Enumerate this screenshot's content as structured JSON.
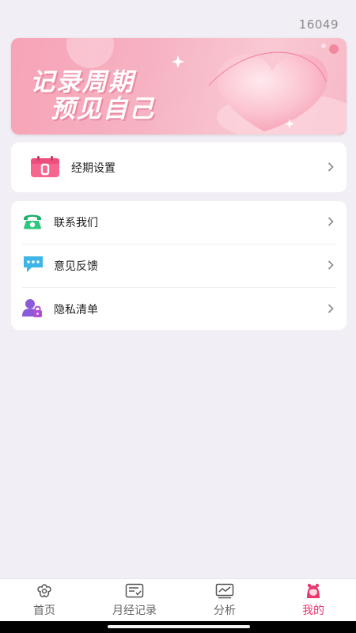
{
  "status": {
    "id_number": "16049"
  },
  "banner": {
    "line1": "记录周期",
    "line2": "预见自己",
    "colors": {
      "accent": "#f7a3b6"
    }
  },
  "period_card": {
    "label": "经期设置",
    "icon": "calendar-icon"
  },
  "menu": {
    "items": [
      {
        "label": "联系我们",
        "icon": "phone-icon"
      },
      {
        "label": "意见反馈",
        "icon": "chat-bubble-icon"
      },
      {
        "label": "隐私清单",
        "icon": "user-lock-icon"
      }
    ]
  },
  "tabbar": {
    "items": [
      {
        "label": "首页",
        "icon": "flower-home-icon",
        "active": false
      },
      {
        "label": "月经记录",
        "icon": "record-icon",
        "active": false
      },
      {
        "label": "分析",
        "icon": "chart-monitor-icon",
        "active": false
      },
      {
        "label": "我的",
        "icon": "profile-icon",
        "active": true
      }
    ],
    "active_color": "#e8386e"
  }
}
